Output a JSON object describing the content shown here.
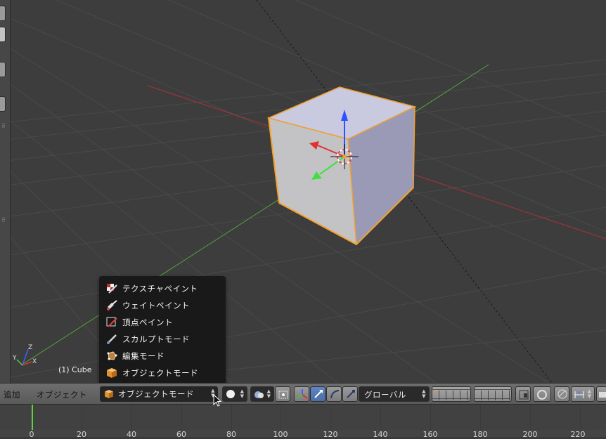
{
  "viewport": {
    "object_label": "(1) Cube",
    "axis_labels": {
      "x": "X",
      "y": "Y",
      "z": "Z"
    }
  },
  "mode_menu": {
    "items": [
      {
        "label": "テクスチャペイント",
        "icon": "texture-paint-icon"
      },
      {
        "label": "ウェイトペイント",
        "icon": "weight-paint-icon"
      },
      {
        "label": "頂点ペイント",
        "icon": "vertex-paint-icon"
      },
      {
        "label": "スカルプトモード",
        "icon": "sculpt-icon"
      },
      {
        "label": "編集モード",
        "icon": "edit-mode-icon"
      },
      {
        "label": "オブジェクトモード",
        "icon": "object-mode-icon"
      }
    ]
  },
  "header": {
    "add_label": "追加",
    "object_label": "オブジェクト",
    "mode_value": "オブジェクトモード",
    "orientation_value": "グローバル"
  },
  "timeline": {
    "ticks": [
      "0",
      "20",
      "40",
      "60",
      "80",
      "100",
      "120",
      "140",
      "160",
      "180",
      "200",
      "220"
    ],
    "current_frame": 1
  },
  "colors": {
    "x_axis": "#c03030",
    "y_axis": "#60b040",
    "selection": "#f0a030",
    "active_blue": "#5680c2"
  }
}
